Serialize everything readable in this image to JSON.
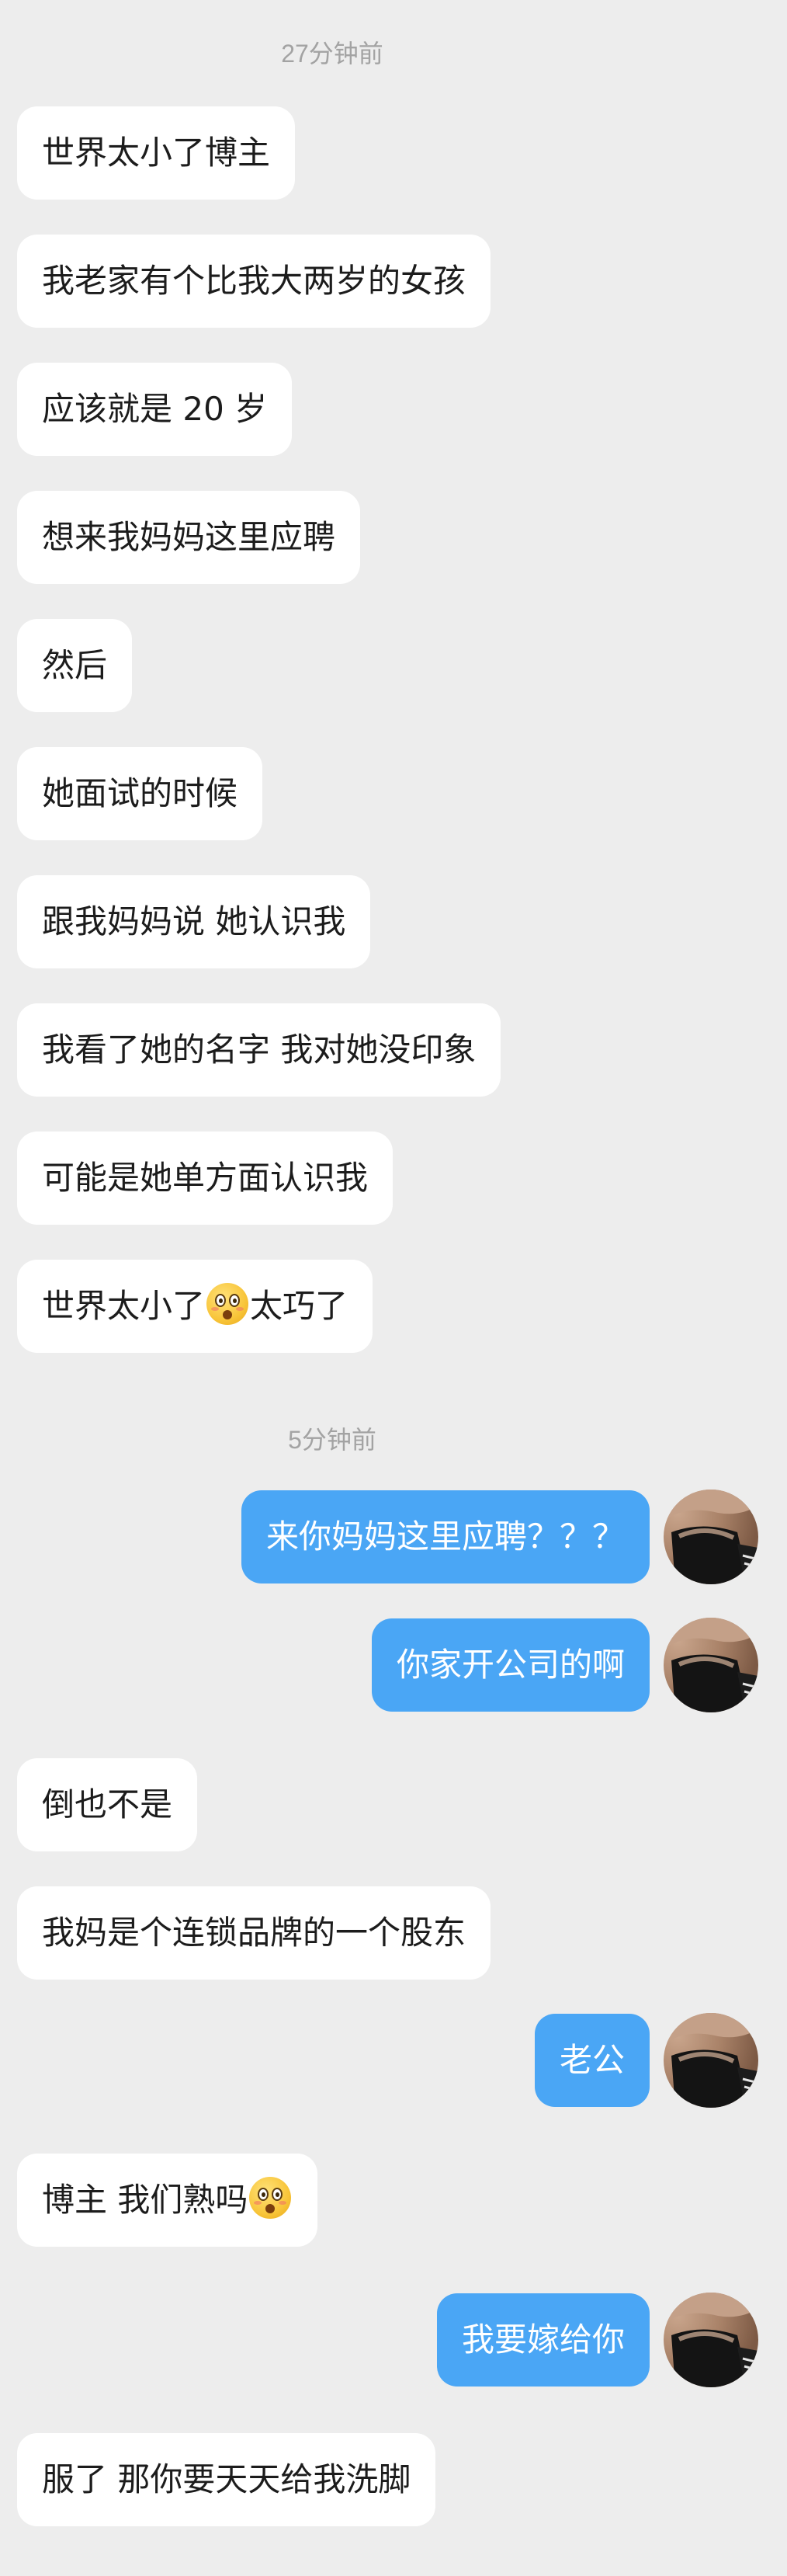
{
  "messages": [
    {
      "kind": "time",
      "text": "27分钟前"
    },
    {
      "kind": "in",
      "text": "世界太小了博主"
    },
    {
      "kind": "in",
      "text": "我老家有个比我大两岁的女孩"
    },
    {
      "kind": "in",
      "text": "应该就是 20 岁"
    },
    {
      "kind": "in",
      "text": "想来我妈妈这里应聘"
    },
    {
      "kind": "in",
      "text": "然后"
    },
    {
      "kind": "in",
      "text": "她面试的时候"
    },
    {
      "kind": "in",
      "text": "跟我妈妈说 她认识我"
    },
    {
      "kind": "in",
      "text": "我看了她的名字 我对她没印象"
    },
    {
      "kind": "in",
      "text": "可能是她单方面认识我"
    },
    {
      "kind": "in",
      "text": "世界太小了",
      "emoji": "astonished-emoji",
      "text_after": "太巧了"
    },
    {
      "kind": "time",
      "text": "5分钟前"
    },
    {
      "kind": "out",
      "text": "来你妈妈这里应聘？？？"
    },
    {
      "kind": "out",
      "text": "你家开公司的啊"
    },
    {
      "kind": "in",
      "text": "倒也不是"
    },
    {
      "kind": "in",
      "text": "我妈是个连锁品牌的一个股东"
    },
    {
      "kind": "out",
      "text": "老公"
    },
    {
      "kind": "in",
      "text": "博主 我们熟吗",
      "emoji": "astonished-emoji",
      "text_after": ""
    },
    {
      "kind": "out",
      "text": "我要嫁给你"
    },
    {
      "kind": "in",
      "text": "服了 那你要天天给我洗脚"
    }
  ],
  "colors": {
    "background": "#ededed",
    "incoming_bubble": "#ffffff",
    "outgoing_bubble": "#4aa6f5",
    "timestamp": "#a3a3a3"
  }
}
